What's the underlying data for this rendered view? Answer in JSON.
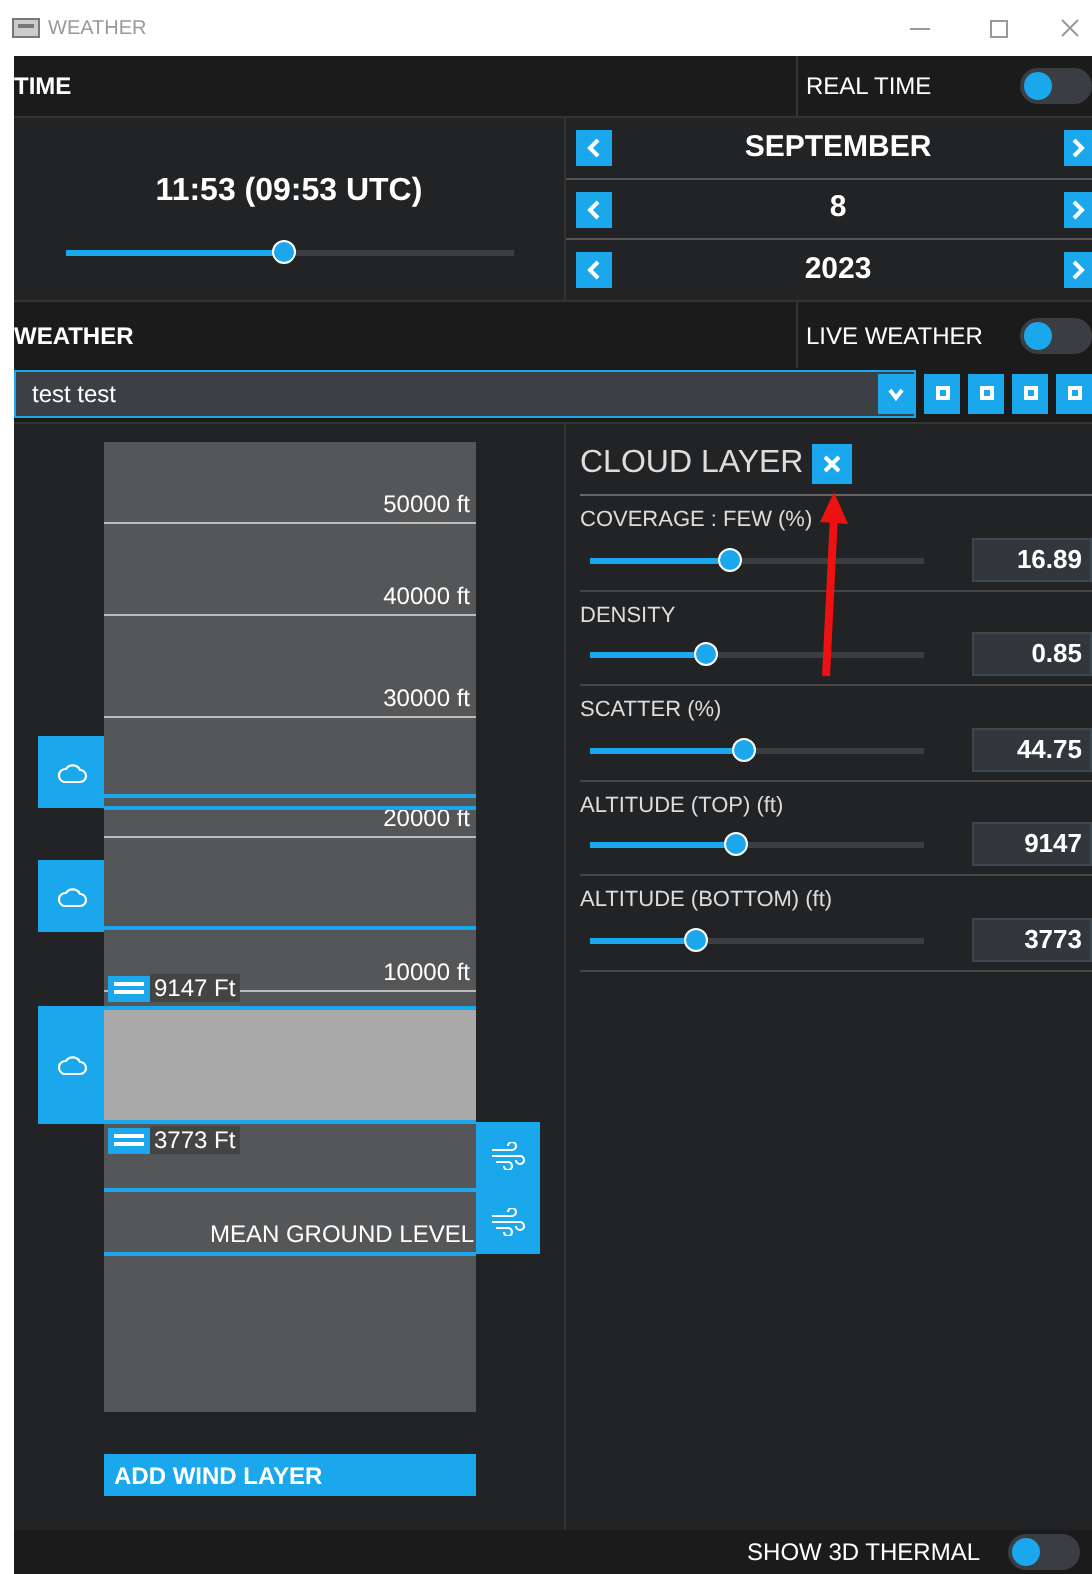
{
  "window": {
    "title": "WEATHER"
  },
  "time": {
    "header": "TIME",
    "real_time": {
      "label": "REAL TIME",
      "on": false
    },
    "clock": "11:53 (09:53 UTC)",
    "level": 0.49,
    "date": [
      {
        "value": "SEPTEMBER"
      },
      {
        "value": "8"
      },
      {
        "value": "2023"
      }
    ]
  },
  "weather": {
    "header": "WEATHER",
    "live_weather": {
      "label": "LIVE WEATHER",
      "on": false
    },
    "preset": "test test"
  },
  "altitude_scale": [
    {
      "label": "50000 ft"
    },
    {
      "label": "40000 ft"
    },
    {
      "label": "30000 ft"
    },
    {
      "label": "20000 ft"
    },
    {
      "label": "10000 ft"
    }
  ],
  "cloud_layers": [
    {
      "selected": false
    },
    {
      "selected": false
    },
    {
      "selected": true
    }
  ],
  "handles": [
    {
      "label": "9147 Ft"
    },
    {
      "label": "3773 Ft"
    }
  ],
  "ground_label": "MEAN GROUND LEVEL",
  "add_wind_layer": "ADD WIND LAYER",
  "cloud_layer": {
    "title": "CLOUD LAYER",
    "sliders": [
      {
        "label": "COVERAGE : FEW (%)",
        "level": 0.42,
        "value": "16.89"
      },
      {
        "label": "DENSITY",
        "level": 0.35,
        "value": "0.85"
      },
      {
        "label": "SCATTER (%)",
        "level": 0.46,
        "value": "44.75"
      },
      {
        "label": "ALTITUDE (TOP) (ft)",
        "level": 0.44,
        "value": "9147"
      },
      {
        "label": "ALTITUDE (BOTTOM) (ft)",
        "level": 0.32,
        "value": "3773"
      }
    ]
  },
  "show_3d_thermal": {
    "label": "SHOW 3D THERMAL",
    "on": false
  }
}
